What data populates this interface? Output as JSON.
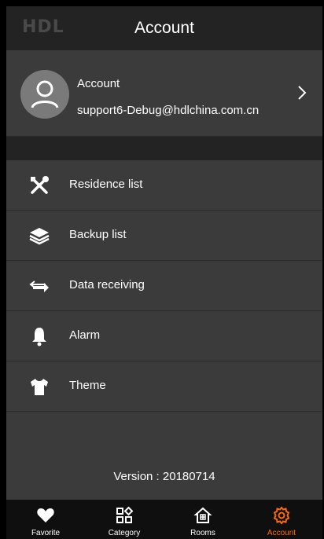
{
  "header": {
    "brand": "HDL",
    "title": "Account"
  },
  "profile": {
    "name": "Account",
    "email": "support6-Debug@hdlchina.com.cn",
    "avatar_icon": "user-icon",
    "chevron_icon": "chevron-right-icon"
  },
  "menu": {
    "items": [
      {
        "label": "Residence list",
        "icon": "tools-icon"
      },
      {
        "label": "Backup list",
        "icon": "layers-icon"
      },
      {
        "label": "Data receiving",
        "icon": "data-transfer-icon"
      },
      {
        "label": "Alarm",
        "icon": "bell-icon"
      },
      {
        "label": "Theme",
        "icon": "tshirt-icon"
      }
    ]
  },
  "version": "Version : 20180714",
  "tabbar": {
    "tabs": [
      {
        "label": "Favorite",
        "icon": "heart-icon"
      },
      {
        "label": "Category",
        "icon": "category-icon"
      },
      {
        "label": "Rooms",
        "icon": "home-icon"
      },
      {
        "label": "Account",
        "icon": "gear-icon",
        "active": true
      }
    ]
  },
  "colors": {
    "accent": "#ff6a00",
    "background": "#3b3b3b",
    "header": "#232323",
    "tabbar": "#0f0f0f"
  }
}
